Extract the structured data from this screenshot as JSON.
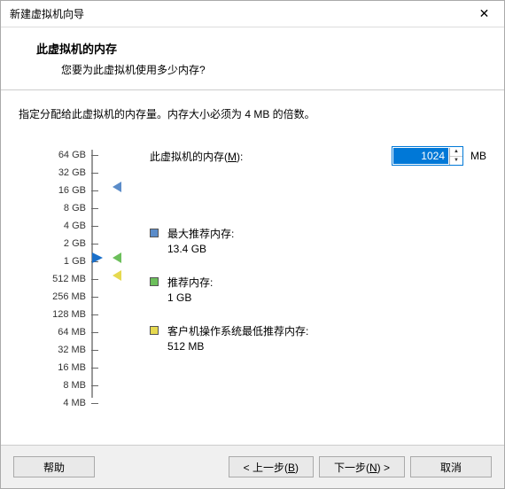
{
  "window": {
    "title": "新建虚拟机向导"
  },
  "header": {
    "title": "此虚拟机的内存",
    "subtitle": "您要为此虚拟机使用多少内存?"
  },
  "instruction": "指定分配给此虚拟机的内存量。内存大小必须为 4 MB 的倍数。",
  "field": {
    "label_pre": "此虚拟机的内存(",
    "label_key": "M",
    "label_post": "):",
    "value": "1024",
    "unit": "MB"
  },
  "scale": {
    "ticks": [
      "64 GB",
      "32 GB",
      "16 GB",
      "8 GB",
      "4 GB",
      "2 GB",
      "1 GB",
      "512 MB",
      "256 MB",
      "128 MB",
      "64 MB",
      "32 MB",
      "16 MB",
      "8 MB",
      "4 MB"
    ]
  },
  "markers": {
    "max_color": "#5b8cc9",
    "rec_color": "#6cbf5b",
    "min_color": "#e6d94f"
  },
  "recommend": {
    "max_label": "最大推荐内存:",
    "max_value": "13.4 GB",
    "rec_label": "推荐内存:",
    "rec_value": "1 GB",
    "min_label": "客户机操作系统最低推荐内存:",
    "min_value": "512 MB"
  },
  "footer": {
    "help": "帮助",
    "back_pre": "< 上一步(",
    "back_key": "B",
    "back_post": ")",
    "next_pre": "下一步(",
    "next_key": "N",
    "next_post": ") >",
    "cancel": "取消"
  }
}
